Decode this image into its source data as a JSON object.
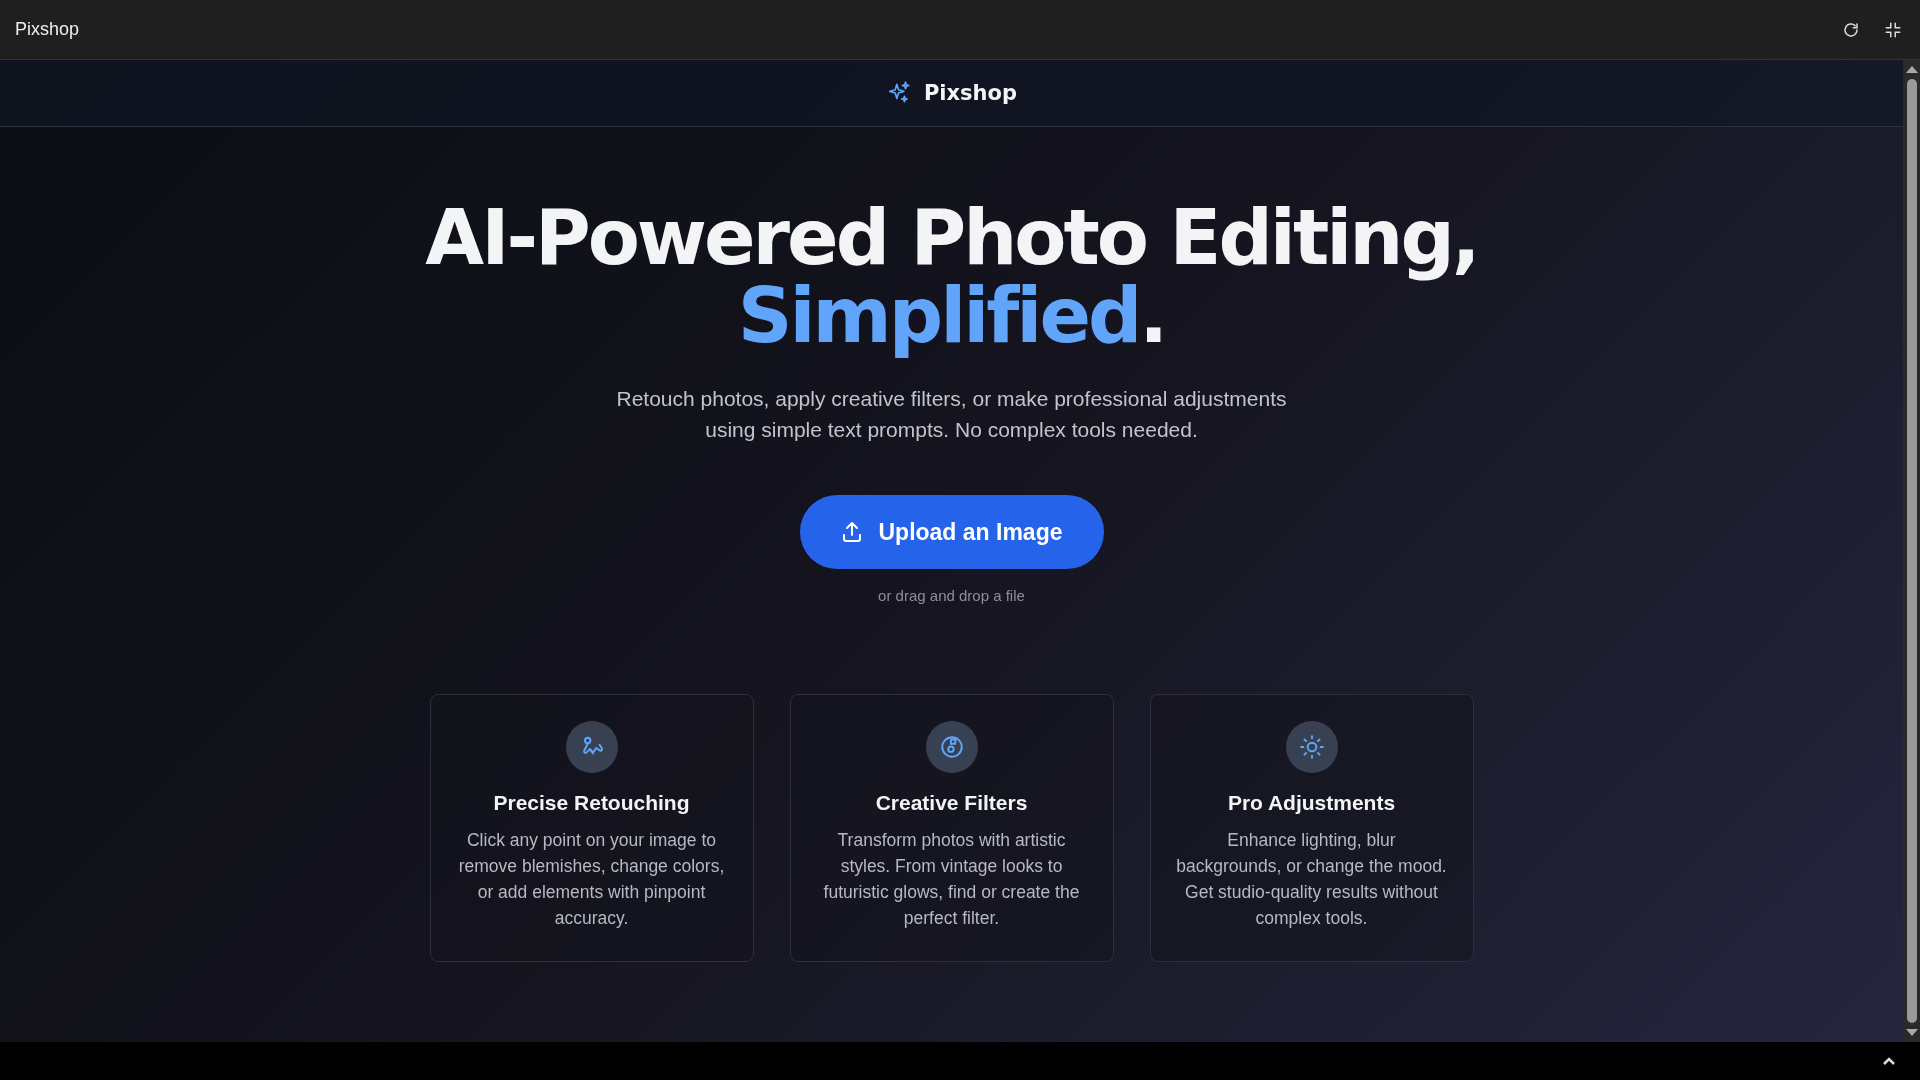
{
  "window": {
    "title": "Pixshop"
  },
  "header": {
    "brand": "Pixshop"
  },
  "hero": {
    "headline": "AI-Powered Photo Editing,",
    "highlight": "Simplified",
    "ending": ".",
    "subtitle": "Retouch photos, apply creative filters, or make professional adjustments using simple text prompts. No complex tools needed.",
    "upload_button": "Upload an Image",
    "hint": "or drag and drop a file"
  },
  "features": [
    {
      "kind": "retouch",
      "title": "Precise Retouching",
      "text": "Click any point on your image to remove blemishes, change colors, or add elements with pinpoint accuracy."
    },
    {
      "kind": "filters",
      "title": "Creative Filters",
      "text": "Transform photos with artistic styles. From vintage looks to futuristic glows, find or create the perfect filter."
    },
    {
      "kind": "adjust",
      "title": "Pro Adjustments",
      "text": "Enhance lighting, blur backgrounds, or change the mood. Get studio-quality results without complex tools."
    }
  ]
}
